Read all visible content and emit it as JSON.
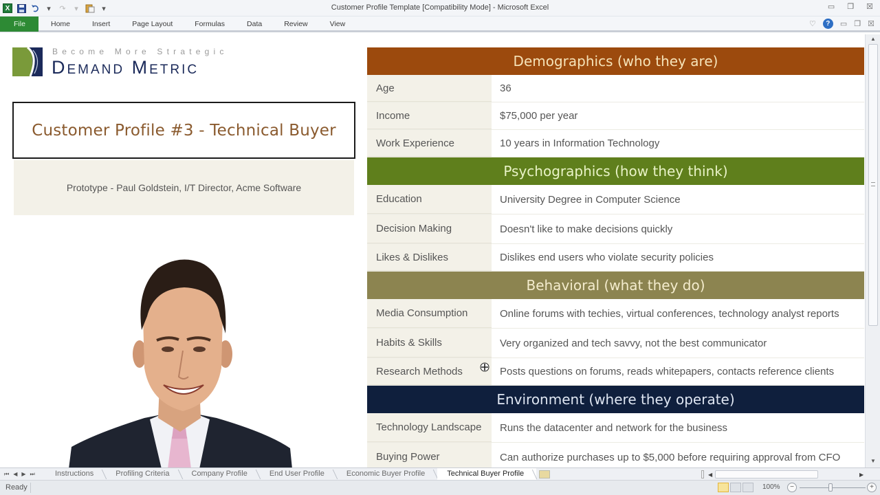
{
  "window": {
    "title": "Customer Profile Template  [Compatibility Mode]  -  Microsoft Excel",
    "controls": [
      "minimize-icon",
      "restore-icon",
      "close-icon"
    ]
  },
  "quick_access": {
    "app_icon": "X",
    "icons": [
      "excel-icon",
      "save-icon",
      "undo-icon",
      "redo-icon",
      "paste-icon",
      "customize-icon"
    ]
  },
  "ribbon": {
    "tabs": [
      "File",
      "Home",
      "Insert",
      "Page Layout",
      "Formulas",
      "Data",
      "Review",
      "View"
    ],
    "right_icons": [
      "minimize-ribbon-icon",
      "help-icon",
      "minimize-window-icon",
      "restore-window-icon",
      "close-window-icon"
    ],
    "help_glyph": "?"
  },
  "logo": {
    "tagline": "Become More Strategic",
    "name": "Demand Metric",
    "colors": {
      "green": "#7a9a3a",
      "navy": "#1b2a5a"
    }
  },
  "profile": {
    "title": "Customer Profile #3  - Technical Buyer",
    "prototype": "Prototype - Paul Goldstein, I/T Director, Acme Software",
    "photo": "person-photo"
  },
  "sections": [
    {
      "title": "Demographics (who they are)",
      "bg": "#9c4a0d",
      "fg": "#f6e3b8",
      "rows": [
        {
          "label": "Age",
          "value": "36"
        },
        {
          "label": "Income",
          "value": "$75,000 per year"
        },
        {
          "label": "Work Experience",
          "value": "10 years in Information Technology"
        }
      ]
    },
    {
      "title": "Psychographics (how they think)",
      "bg": "#5f7f1c",
      "fg": "#e9f3c7",
      "rows": [
        {
          "label": "Education",
          "value": "University Degree in Computer Science"
        },
        {
          "label": "Decision Making",
          "value": "Doesn't like to make decisions quickly"
        },
        {
          "label": "Likes & Dislikes",
          "value": "Dislikes end users who violate security policies"
        }
      ]
    },
    {
      "title": "Behavioral (what they do)",
      "bg": "#8c8450",
      "fg": "#f4eccd",
      "rows": [
        {
          "label": "Media Consumption",
          "value": "Online forums with techies, virtual conferences, technology analyst reports"
        },
        {
          "label": "Habits & Skills",
          "value": "Very organized and tech savvy, not the best communicator"
        },
        {
          "label": "Research Methods",
          "value": "Posts questions on forums, reads whitepapers, contacts reference clients"
        }
      ]
    },
    {
      "title": "Environment (where they operate)",
      "bg": "#0f1f3d",
      "fg": "#dfe6f2",
      "rows": [
        {
          "label": "Technology Landscape",
          "value": "Runs the datacenter and network for the business"
        },
        {
          "label": "Buying Power",
          "value": "Can authorize purchases up to $5,000 before requiring approval from CFO"
        }
      ]
    }
  ],
  "sheet_tabs": {
    "tabs": [
      "Instructions",
      "Profiling Criteria",
      "Company Profile",
      "End User Profile",
      "Economic Buyer Profile",
      "Technical Buyer Profile"
    ],
    "active": "Technical Buyer Profile"
  },
  "status": {
    "text": "Ready",
    "zoom": "100%",
    "zoom_out": "−",
    "zoom_in": "+"
  }
}
